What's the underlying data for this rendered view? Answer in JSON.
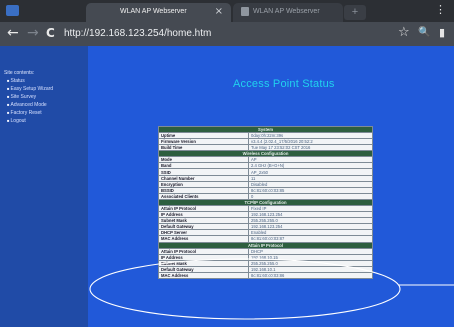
{
  "browser": {
    "app_label": "",
    "active_tab": {
      "title": "WLAN AP Webserver",
      "close": "×"
    },
    "inactive_tab": {
      "title": "WLAN AP Webserver"
    },
    "new_tab": "+",
    "menu": "⋮",
    "back": "←",
    "forward": "→",
    "reload": "C",
    "url": "http://192.168.123.254/home.htm",
    "bookmark": "☆",
    "search": "🔍",
    "overflow": "▮"
  },
  "sidebar": {
    "title": "Site contents:",
    "items": [
      {
        "label": "Status"
      },
      {
        "label": "Easy Setup Wizard"
      },
      {
        "label": "Site Survey"
      },
      {
        "label": "Advanced Mode"
      },
      {
        "label": "Factory Reset"
      },
      {
        "label": "Logout"
      }
    ]
  },
  "main": {
    "title": "Access Point Status",
    "sections": [
      {
        "header": "System",
        "rows": [
          {
            "label": "Uptime",
            "value": "0day:0h:22m:39s"
          },
          {
            "label": "Firmware Version",
            "value": "v3.4.4 (2.02.4_17/5/2016 20:52:2"
          },
          {
            "label": "Build Time",
            "value": "Tue May 17 23:52:02 CST 2016"
          }
        ]
      },
      {
        "header": "Wireless Configuration",
        "rows": [
          {
            "label": "Mode",
            "value": "AP"
          },
          {
            "label": "Band",
            "value": "2.4 GHz (B+G+N)"
          },
          {
            "label": "SSID",
            "value": "AP_2x50"
          },
          {
            "label": "Channel Number",
            "value": "11"
          },
          {
            "label": "Encryption",
            "value": "Disabled"
          },
          {
            "label": "BSSID",
            "value": "8c:81:60:c0:03:85"
          },
          {
            "label": "Associated Clients",
            "value": "0"
          }
        ]
      },
      {
        "header": "TCP/IP Configuration",
        "rows": [
          {
            "label": "Attain IP Protocol",
            "value": "Fixed IP"
          },
          {
            "label": "IP Address",
            "value": "192.168.123.254"
          },
          {
            "label": "Subnet Mask",
            "value": "255.255.255.0"
          },
          {
            "label": "Default Gateway",
            "value": "192.168.123.254"
          },
          {
            "label": "DHCP Server",
            "value": "Enabled"
          },
          {
            "label": "MAC Address",
            "value": "8c:81:60:c0:03:87"
          }
        ]
      },
      {
        "header": "Attain IP Protocol",
        "rows": [
          {
            "label": "Attain IP Protocol",
            "value": "DHCP"
          },
          {
            "label": "IP Address",
            "value": "192.168.10.15"
          },
          {
            "label": "Subnet Mask",
            "value": "255.255.255.0"
          },
          {
            "label": "Default Gateway",
            "value": "192.168.10.1"
          },
          {
            "label": "MAC Address",
            "value": "8c:81:60:c0:03:86"
          }
        ]
      }
    ]
  },
  "colors": {
    "page_bg": "#2159d9",
    "sidebar_bg": "#204ba7",
    "title": "#20d2ee",
    "section_header": "#2d5e3f"
  }
}
